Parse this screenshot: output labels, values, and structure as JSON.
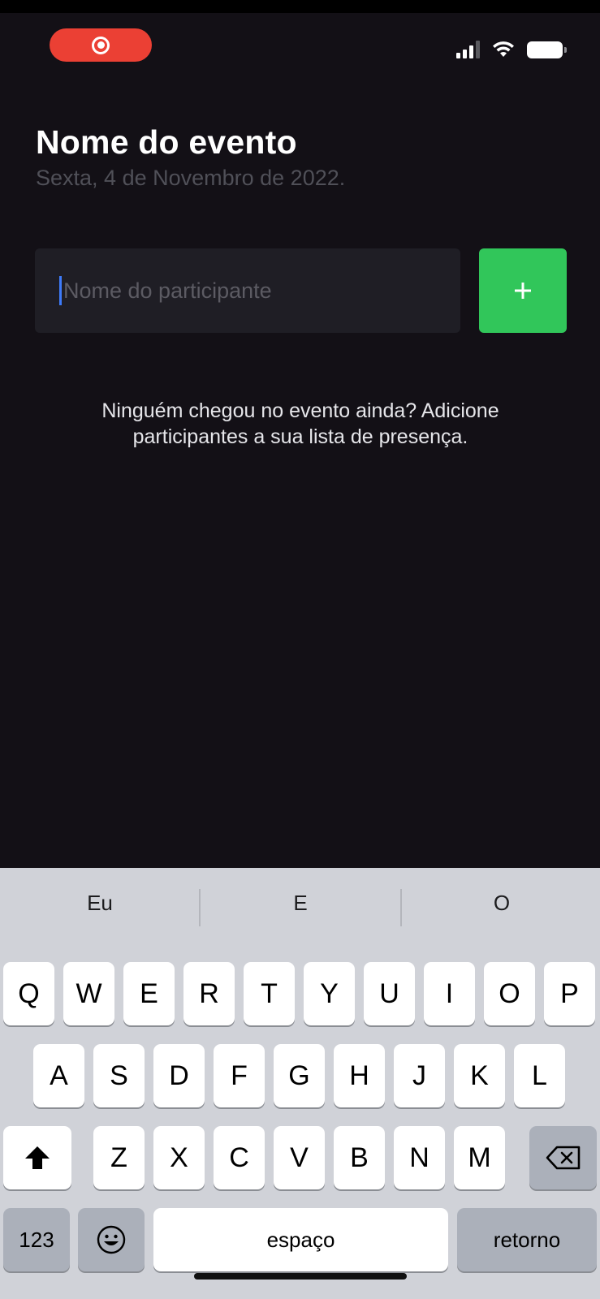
{
  "status_bar": {
    "recording_indicator": "screen-recording-icon",
    "icons": [
      "cellular-signal-icon",
      "wifi-icon",
      "battery-icon"
    ]
  },
  "event": {
    "title": "Nome do evento",
    "date": "Sexta, 4 de Novembro de 2022."
  },
  "participant_input": {
    "value": "",
    "placeholder": "Nome do participante"
  },
  "add_button": {
    "icon": "plus-icon",
    "label": "+"
  },
  "empty_state": {
    "line1": "Ninguém chegou no evento ainda? Adicione",
    "line2": "participantes a sua lista de presença."
  },
  "keyboard": {
    "suggestions": [
      "Eu",
      "E",
      "O"
    ],
    "row1": [
      "Q",
      "W",
      "E",
      "R",
      "T",
      "Y",
      "U",
      "I",
      "O",
      "P"
    ],
    "row2": [
      "A",
      "S",
      "D",
      "F",
      "G",
      "H",
      "J",
      "K",
      "L"
    ],
    "row3": [
      "Z",
      "X",
      "C",
      "V",
      "B",
      "N",
      "M"
    ],
    "shift_icon": "shift-arrow-icon",
    "delete_icon": "backspace-icon",
    "numbers_label": "123",
    "emoji_icon": "emoji-icon",
    "space_label": "espaço",
    "return_label": "retorno"
  },
  "colors": {
    "background": "#131016",
    "input_bg": "#1f1e25",
    "accent_green": "#31c65a",
    "record_red": "#eb4034",
    "caret_blue": "#3e7bfa"
  }
}
